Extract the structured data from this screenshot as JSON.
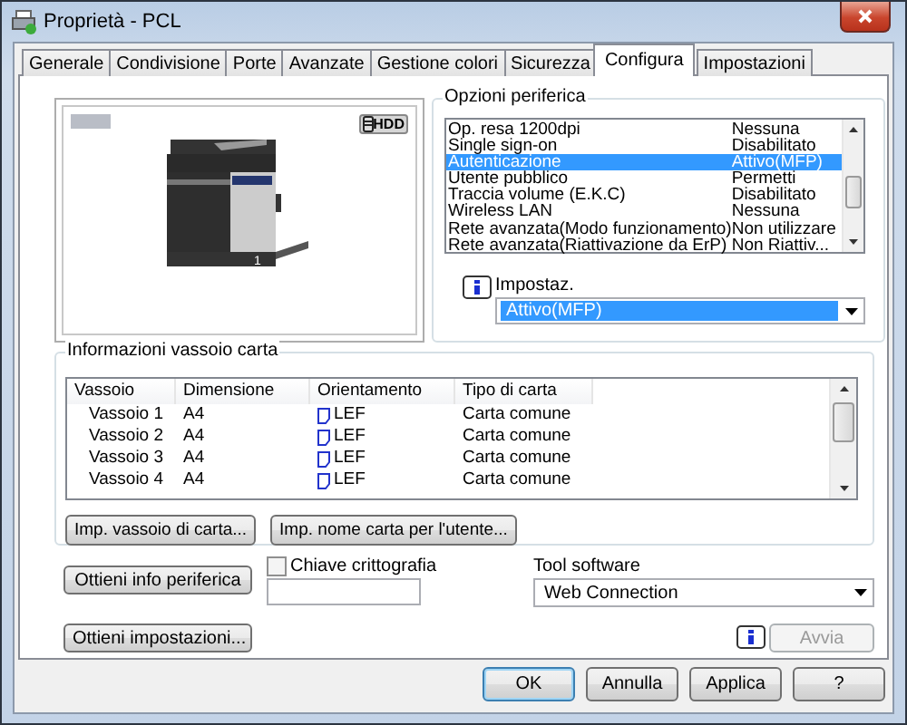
{
  "window": {
    "title": "Proprietà - PCL"
  },
  "tabs": [
    {
      "label": "Generale",
      "selected": false
    },
    {
      "label": "Condivisione",
      "selected": false
    },
    {
      "label": "Porte",
      "selected": false
    },
    {
      "label": "Avanzate",
      "selected": false
    },
    {
      "label": "Gestione colori",
      "selected": false
    },
    {
      "label": "Sicurezza",
      "selected": false
    },
    {
      "label": "Configura",
      "selected": true
    },
    {
      "label": "Impostazioni",
      "selected": false
    }
  ],
  "preview": {
    "badge": "HDD",
    "unit_number": "1"
  },
  "device_options": {
    "title": "Opzioni periferica",
    "rows": [
      {
        "name": "Op. resa 1200dpi",
        "value": "Nessuna",
        "selected": false
      },
      {
        "name": "Single sign-on",
        "value": "Disabilitato",
        "selected": false
      },
      {
        "name": "Autenticazione",
        "value": "Attivo(MFP)",
        "selected": true
      },
      {
        "name": "Utente pubblico",
        "value": "Permetti",
        "selected": false
      },
      {
        "name": "Traccia volume (E.K.C)",
        "value": "Disabilitato",
        "selected": false
      },
      {
        "name": "Wireless LAN",
        "value": "Nessuna",
        "selected": false
      },
      {
        "name": "Rete avanzata(Modo funzionamento)",
        "value": "Non utilizzare",
        "selected": false
      },
      {
        "name": "Rete avanzata(Riattivazione da ErP)",
        "value": "Non Riattiv...",
        "selected": false
      }
    ],
    "setting_label": "Impostaz.",
    "setting_value": "Attivo(MFP)"
  },
  "paper_tray": {
    "title": "Informazioni vassoio carta",
    "columns": [
      "Vassoio",
      "Dimensione",
      "Orientamento",
      "Tipo di carta"
    ],
    "rows": [
      {
        "tray": "Vassoio 1",
        "size": "A4",
        "orientation": "LEF",
        "paper_type": "Carta comune"
      },
      {
        "tray": "Vassoio 2",
        "size": "A4",
        "orientation": "LEF",
        "paper_type": "Carta comune"
      },
      {
        "tray": "Vassoio 3",
        "size": "A4",
        "orientation": "LEF",
        "paper_type": "Carta comune"
      },
      {
        "tray": "Vassoio 4",
        "size": "A4",
        "orientation": "LEF",
        "paper_type": "Carta comune"
      }
    ],
    "buttons": [
      "Imp. vassoio di carta...",
      "Imp. nome carta per l'utente..."
    ]
  },
  "get_device_info_button": "Ottieni info periferica",
  "encryption_key": {
    "label": "Chiave crittografia",
    "checked": false
  },
  "tool_software": {
    "label": "Tool software",
    "value": "Web Connection"
  },
  "get_settings_button": "Ottieni impostazioni...",
  "start_button": {
    "label": "Avvia",
    "disabled": true
  },
  "footer_buttons": [
    {
      "label": "OK",
      "default": true
    },
    {
      "label": "Annulla",
      "default": false
    },
    {
      "label": "Applica",
      "default": false
    },
    {
      "label": "?",
      "default": false
    }
  ]
}
